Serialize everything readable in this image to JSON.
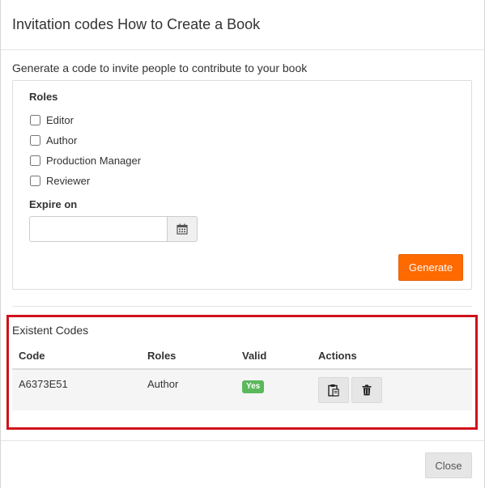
{
  "modal": {
    "title": "Invitation codes How to Create a Book"
  },
  "generate": {
    "intro": "Generate a code to invite people to contribute to your book",
    "roles_label": "Roles",
    "roles": [
      {
        "label": "Editor",
        "checked": false
      },
      {
        "label": "Author",
        "checked": false
      },
      {
        "label": "Production Manager",
        "checked": false
      },
      {
        "label": "Reviewer",
        "checked": false
      }
    ],
    "expire_label": "Expire on",
    "expire_value": "",
    "calendar_icon": "calendar-icon",
    "generate_label": "Generate"
  },
  "existent": {
    "title": "Existent Codes",
    "columns": [
      "Code",
      "Roles",
      "Valid",
      "Actions"
    ],
    "rows": [
      {
        "code": "A6373E51",
        "roles": "Author",
        "valid": "Yes",
        "actions": [
          "clipboard-icon",
          "trash-icon"
        ]
      }
    ]
  },
  "footer": {
    "close_label": "Close"
  },
  "colors": {
    "accent": "#ff6a00",
    "valid_badge": "#5cb85c",
    "highlight": "#d0111b"
  }
}
